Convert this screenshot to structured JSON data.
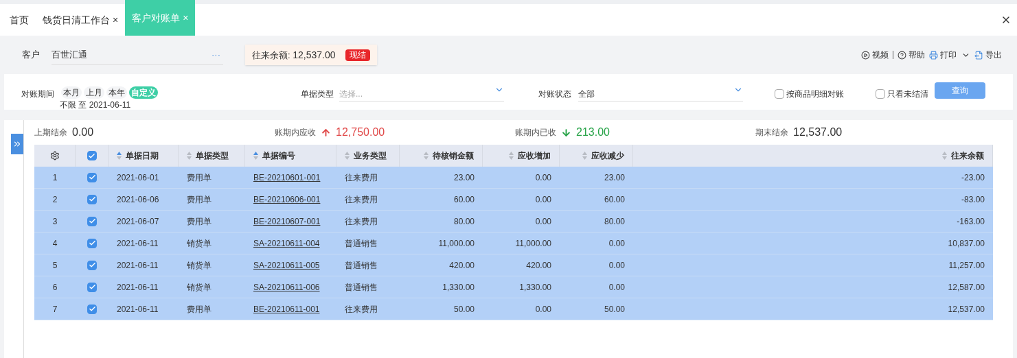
{
  "tabs": [
    {
      "label": "首页",
      "closable": false,
      "selected": false
    },
    {
      "label": "钱货日清工作台",
      "closable": true,
      "selected": false
    },
    {
      "label": "客户对账单",
      "closable": true,
      "selected": true
    }
  ],
  "close_symbol": "×",
  "customer": {
    "label": "客户",
    "value": "百世汇通",
    "more": "···"
  },
  "balance": {
    "label": "往来余额:",
    "value": "12,537.00",
    "badge": "现结"
  },
  "actions": [
    {
      "kind": "video",
      "label": "视频"
    },
    {
      "kind": "help",
      "label": "帮助"
    },
    {
      "kind": "print",
      "label": "打印"
    },
    {
      "kind": "export",
      "label": "导出"
    }
  ],
  "filters": {
    "period_label": "对账期间",
    "periods": [
      {
        "label": "本月",
        "selected": false
      },
      {
        "label": "上月",
        "selected": false
      },
      {
        "label": "本年",
        "selected": false
      },
      {
        "label": "自定义",
        "selected": true
      }
    ],
    "period_range": "不限 至 2021-06-11",
    "doc_type": {
      "label": "单据类型",
      "placeholder": "选择..."
    },
    "status": {
      "label": "对账状态",
      "value": "全部"
    },
    "checkboxes": [
      {
        "label": "按商品明细对账",
        "checked": false
      },
      {
        "label": "只看未结清",
        "checked": false
      }
    ],
    "query_button": "查询"
  },
  "summary": [
    {
      "label": "上期结余",
      "value": "0.00",
      "kind": "plain"
    },
    {
      "label": "账期内应收",
      "value": "12,750.00",
      "kind": "up"
    },
    {
      "label": "账期内已收",
      "value": "213.00",
      "kind": "down"
    },
    {
      "label": "期末结余",
      "value": "12,537.00",
      "kind": "plain"
    }
  ],
  "table": {
    "all_checked": true,
    "columns": [
      {
        "label": "单据日期",
        "sorted": true
      },
      {
        "label": "单据类型",
        "sorted": false
      },
      {
        "label": "单据编号",
        "sorted": true
      },
      {
        "label": "业务类型",
        "sorted": false
      },
      {
        "label": "待核销金额",
        "sorted": false
      },
      {
        "label": "应收增加",
        "sorted": false
      },
      {
        "label": "应收减少",
        "sorted": false
      },
      {
        "label": "往来余额",
        "sorted": false
      }
    ],
    "rows": [
      {
        "index": "1",
        "checked": true,
        "selected": true,
        "cells": [
          "2021-06-01",
          "费用单",
          "BE-20210601-001",
          "往来费用",
          "23.00",
          "0.00",
          "23.00",
          "-23.00"
        ]
      },
      {
        "index": "2",
        "checked": true,
        "selected": true,
        "cells": [
          "2021-06-06",
          "费用单",
          "BE-20210606-001",
          "往来费用",
          "60.00",
          "0.00",
          "60.00",
          "-83.00"
        ]
      },
      {
        "index": "3",
        "checked": true,
        "selected": true,
        "cells": [
          "2021-06-07",
          "费用单",
          "BE-20210607-001",
          "往来费用",
          "80.00",
          "0.00",
          "80.00",
          "-163.00"
        ]
      },
      {
        "index": "4",
        "checked": true,
        "selected": true,
        "cells": [
          "2021-06-11",
          "销货单",
          "SA-20210611-004",
          "普通销售",
          "11,000.00",
          "11,000.00",
          "0.00",
          "10,837.00"
        ]
      },
      {
        "index": "5",
        "checked": true,
        "selected": true,
        "cells": [
          "2021-06-11",
          "销货单",
          "SA-20210611-005",
          "普通销售",
          "420.00",
          "420.00",
          "0.00",
          "11,257.00"
        ]
      },
      {
        "index": "6",
        "checked": true,
        "selected": true,
        "cells": [
          "2021-06-11",
          "销货单",
          "SA-20210611-006",
          "普通销售",
          "1,330.00",
          "1,330.00",
          "0.00",
          "12,587.00"
        ]
      },
      {
        "index": "7",
        "checked": true,
        "selected": true,
        "cells": [
          "2021-06-11",
          "费用单",
          "BE-20210611-001",
          "往来费用",
          "50.00",
          "0.00",
          "50.00",
          "12,537.00"
        ]
      }
    ]
  }
}
